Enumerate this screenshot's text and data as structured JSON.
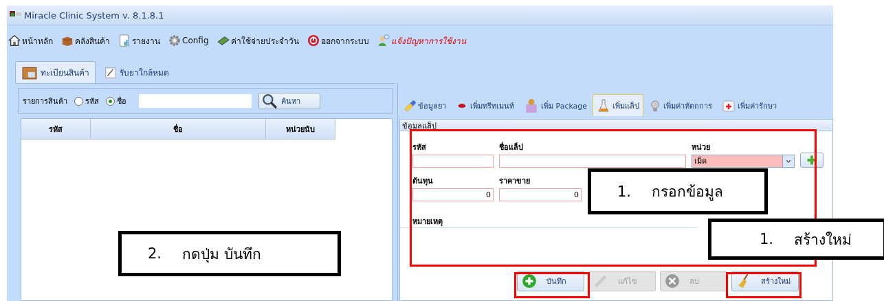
{
  "window": {
    "title": "Miracle Clinic System v. 8.1.8.1"
  },
  "toolbar": [
    {
      "label": "หน้าหลัก",
      "kind": "menu"
    },
    {
      "label": "คลังสินค้า",
      "kind": "menu"
    },
    {
      "label": "รายงาน",
      "kind": "menu"
    },
    {
      "label": "Config",
      "kind": "menu"
    },
    {
      "label": "ค่าใช้จ่ายประจำวัน",
      "kind": "menu"
    },
    {
      "label": "ออกจากระบบ",
      "kind": "menu"
    },
    {
      "label": "แจ้งปัญหาการใช้งาน",
      "kind": "alert"
    }
  ],
  "main_tabs": [
    {
      "label": "ทะเบียนสินค้า",
      "selected": true
    },
    {
      "label": "รับยาใกล้หมด",
      "selected": false
    }
  ],
  "search": {
    "label": "รายการสินค้า",
    "options": [
      {
        "label": "รหัส",
        "selected": false
      },
      {
        "label": "ชื่อ",
        "selected": true
      }
    ],
    "button": "ค้นหา"
  },
  "table": {
    "columns": [
      "รหัส",
      "ชื่อ",
      "หน่วยนับ"
    ]
  },
  "detail_tabs": [
    {
      "label": "ข้อมูลยา",
      "selected": false
    },
    {
      "label": "เพิ่มทรีทเมนท์",
      "selected": false
    },
    {
      "label": "เพิ่ม Package",
      "selected": false
    },
    {
      "label": "เพิ่มแล็ป",
      "selected": true
    },
    {
      "label": "เพิ่มค่าหัตถการ",
      "selected": false
    },
    {
      "label": "เพิ่มค่ารักษา",
      "selected": false
    }
  ],
  "form": {
    "title": "ข้อมูลแล็ป",
    "code": {
      "label": "รหัส"
    },
    "name": {
      "label": "ชื่อแล็ป"
    },
    "unit": {
      "label": "หน่วย",
      "value": "เม็ด"
    },
    "cost": {
      "label": "ต้นทุน",
      "value": "0"
    },
    "price": {
      "label": "ราคาขาย",
      "value": "0"
    },
    "note": {
      "label": "หมายเหตุ"
    }
  },
  "buttons": [
    {
      "label": "บันทึก",
      "disabled": false
    },
    {
      "label": "แก้ไข",
      "disabled": true
    },
    {
      "label": "ลบ",
      "disabled": true
    },
    {
      "label": "สร้างใหม่",
      "disabled": false
    }
  ],
  "callouts": [
    {
      "number": "1.",
      "text": "กรอกข้อมูล"
    },
    {
      "number": "1.",
      "text": "สร้างใหม่"
    },
    {
      "number": "2.",
      "text": "กดปุ่ม บันทึก"
    }
  ]
}
